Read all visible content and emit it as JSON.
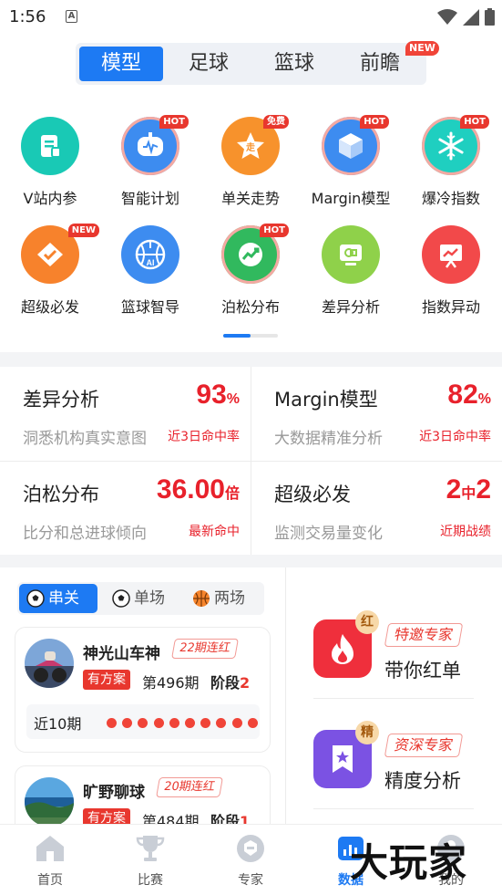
{
  "status_bar": {
    "time": "1:56",
    "a_icon": "A"
  },
  "top_tabs": {
    "items": [
      "模型",
      "足球",
      "篮球",
      "前瞻"
    ],
    "active_index": 0,
    "new_badge": "NEW"
  },
  "grid": {
    "row1": [
      {
        "label": "V站内参",
        "badge": ""
      },
      {
        "label": "智能计划",
        "badge": "HOT"
      },
      {
        "label": "单关走势",
        "badge": "免费"
      },
      {
        "label": "Margin模型",
        "badge": "HOT"
      },
      {
        "label": "爆冷指数",
        "badge": "HOT"
      }
    ],
    "row2": [
      {
        "label": "超级必发",
        "badge": "NEW"
      },
      {
        "label": "篮球智导",
        "badge": ""
      },
      {
        "label": "泊松分布",
        "badge": "HOT"
      },
      {
        "label": "差异分析",
        "badge": ""
      },
      {
        "label": "指数异动",
        "badge": ""
      }
    ],
    "pager": {
      "pages": 2,
      "active": 1
    }
  },
  "stats": [
    {
      "title": "差异分析",
      "value": "93",
      "unit": "%",
      "sub": "洞悉机构真实意图",
      "tag": "近3日命中率"
    },
    {
      "title": "Margin模型",
      "value": "82",
      "unit": "%",
      "sub": "大数据精准分析",
      "tag": "近3日命中率"
    },
    {
      "title": "泊松分布",
      "value": "36.00",
      "unit": "倍",
      "sub": "比分和总进球倾向",
      "tag": "最新命中"
    },
    {
      "title": "超级必发",
      "value_a": "2",
      "value_mid": "中",
      "value_b": "2",
      "sub": "监测交易量变化",
      "tag": "近期战绩"
    }
  ],
  "sub_tabs": {
    "items": [
      "串关",
      "单场",
      "两场"
    ],
    "active_index": 0
  },
  "experts": [
    {
      "name": "神光山车神",
      "streak": "22期连红",
      "plan": "有方案",
      "period": "第496期",
      "stage_label": "阶段",
      "stage_value": "2",
      "recent_label": "近10期",
      "recent_hits": 10
    },
    {
      "name": "旷野聊球",
      "streak": "20期连红",
      "plan": "有方案",
      "period": "第484期",
      "stage_label": "阶段",
      "stage_value": "1"
    }
  ],
  "promos": [
    {
      "badge": "红",
      "tag": "特邀专家",
      "title": "带你红单"
    },
    {
      "badge": "精",
      "tag": "资深专家",
      "title": "精度分析"
    }
  ],
  "bottom_nav": {
    "items": [
      "首页",
      "比赛",
      "专家",
      "数据",
      "我的"
    ],
    "active_index": 3
  },
  "watermark": "大玩家",
  "colors": {
    "accent": "#1d7af3",
    "red": "#e8212b"
  }
}
